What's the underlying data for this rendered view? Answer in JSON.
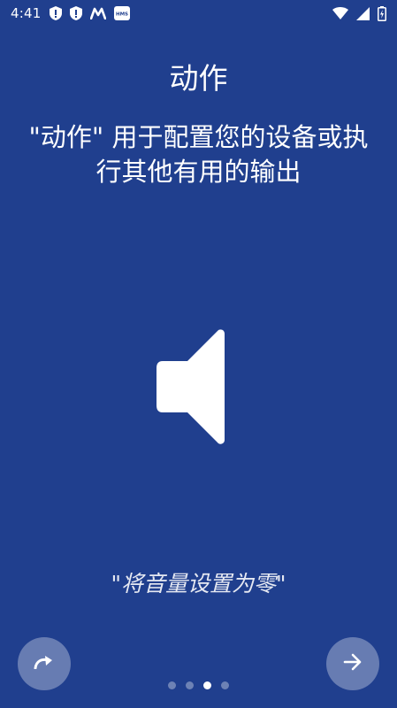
{
  "status_bar": {
    "time": "4:41",
    "left_icons": [
      "shield-alert-icon",
      "shield-alert-icon",
      "m-app-icon",
      "hms-icon"
    ],
    "hms_label": "HMS",
    "right_icons": [
      "wifi-icon",
      "signal-icon",
      "battery-icon"
    ]
  },
  "title": "动作",
  "description": "\"动作\" 用于配置您的设备或执行其他有用的输出",
  "hero_icon": "speaker-icon",
  "example": "\"将音量设置为零\"",
  "controls": {
    "skip_icon": "redo-arrow-icon",
    "next_icon": "arrow-right-icon"
  },
  "pager": {
    "total": 4,
    "active_index": 2
  },
  "colors": {
    "background": "#203f8e",
    "foreground": "#ffffff"
  }
}
